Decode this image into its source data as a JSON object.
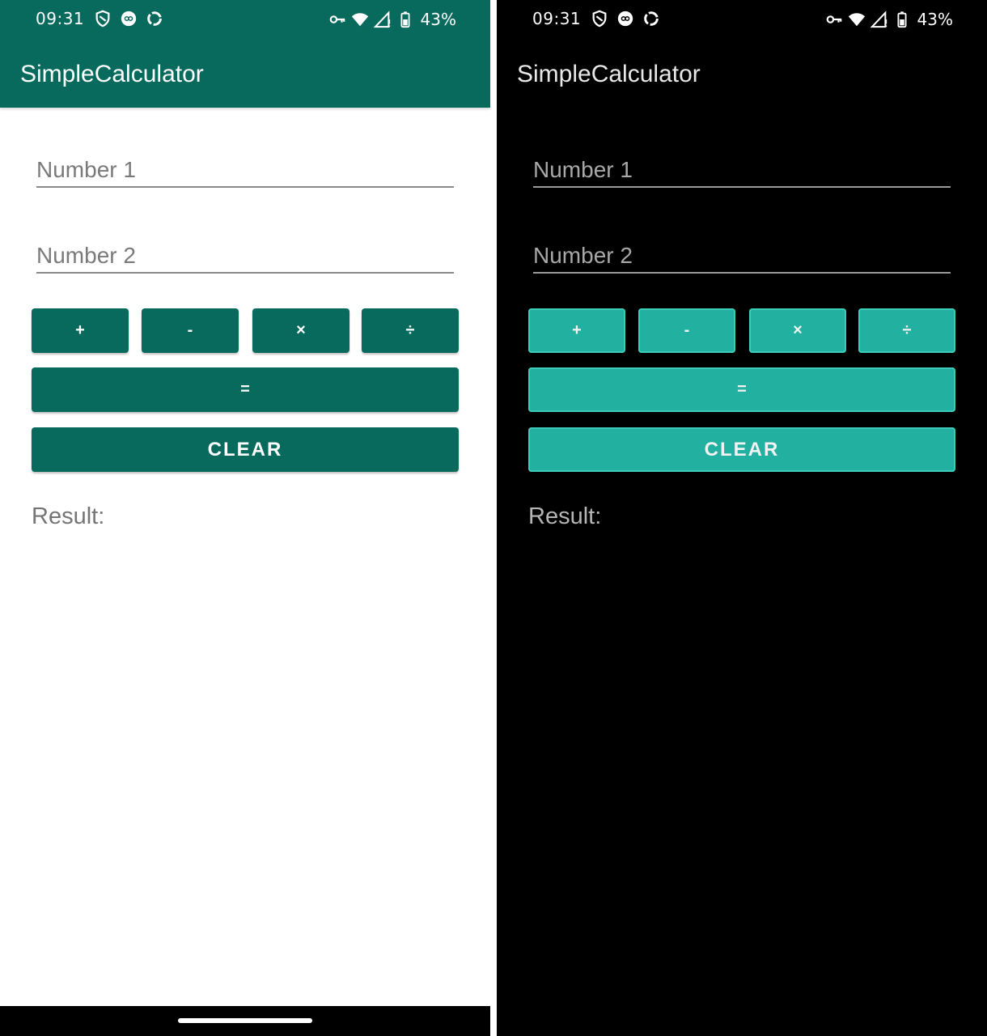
{
  "screens": {
    "light": {
      "theme": "light",
      "status": {
        "time": "09:31",
        "battery": "43%"
      },
      "app_title": "SimpleCalculator",
      "number1_placeholder": "Number 1",
      "number2_placeholder": "Number 2",
      "ops": {
        "add": "+",
        "sub": "-",
        "mul": "×",
        "div": "÷"
      },
      "equals": "=",
      "clear": "CLEAR",
      "result_label": "Result:",
      "colors": {
        "primary": "#076a5d",
        "background": "#ffffff"
      }
    },
    "dark": {
      "theme": "dark",
      "status": {
        "time": "09:31",
        "battery": "43%"
      },
      "app_title": "SimpleCalculator",
      "number1_placeholder": "Number 1",
      "number2_placeholder": "Number 2",
      "ops": {
        "add": "+",
        "sub": "-",
        "mul": "×",
        "div": "÷"
      },
      "equals": "=",
      "clear": "CLEAR",
      "result_label": "Result:",
      "colors": {
        "primary": "#22b0a0",
        "background": "#000000"
      }
    }
  },
  "status_icons": [
    "shield-icon",
    "link-icon",
    "sync-icon",
    "vpn-key-icon",
    "wifi-icon",
    "signal-icon",
    "battery-icon"
  ]
}
